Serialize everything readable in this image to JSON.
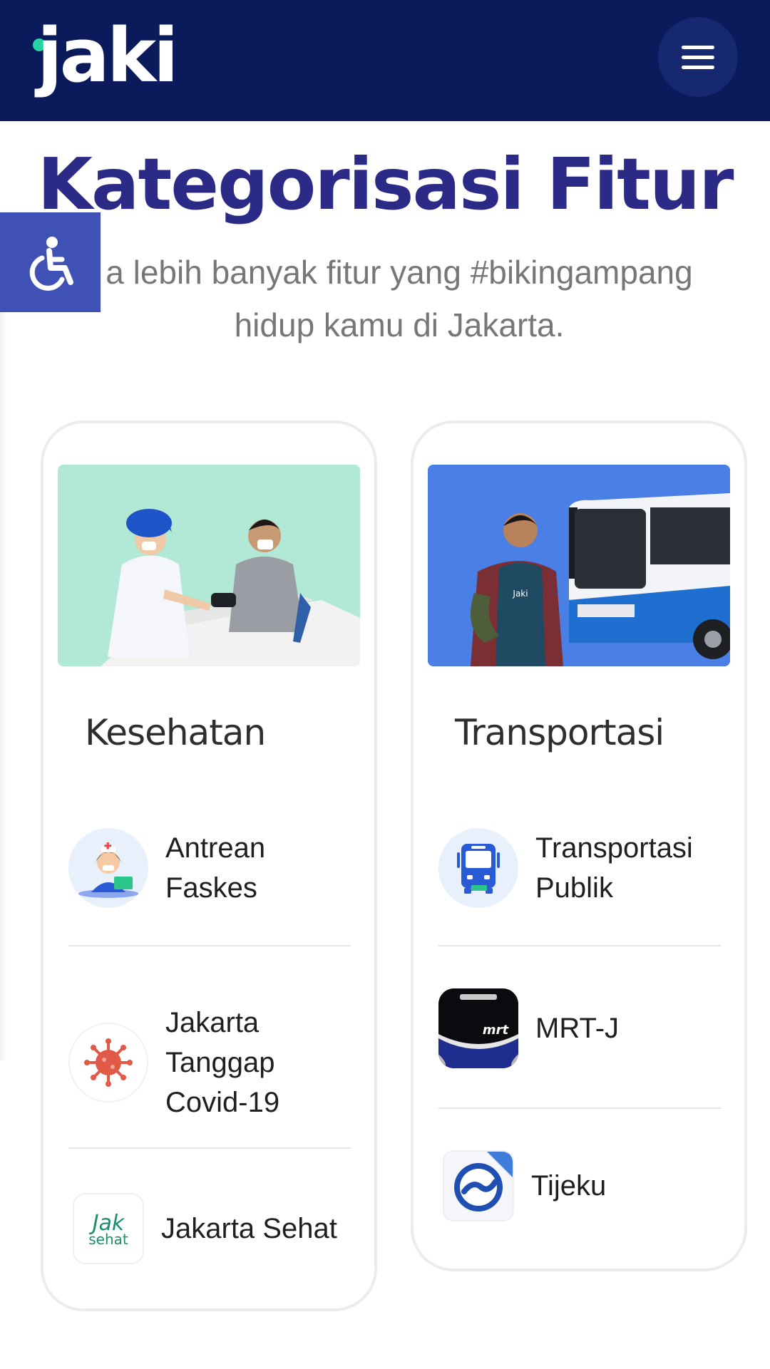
{
  "header": {
    "logo_text": "jaki",
    "logo_dot_color": "#27d3a2",
    "background_color": "#0b1a5a",
    "menu_icon": "hamburger-menu-icon"
  },
  "accessibility": {
    "icon": "wheelchair-icon",
    "color": "#3f51b5"
  },
  "main": {
    "title": "Kategorisasi Fitur",
    "subtitle": "a lebih banyak fitur yang #bikingampang hidup kamu di Jakarta.",
    "title_color": "#2b2a86"
  },
  "categories": [
    {
      "title": "Kesehatan",
      "image": "health-worker-checking-patient-illustration",
      "image_bg": "#b1e8d6",
      "features": [
        {
          "label": "Antrean Faskes",
          "icon": "nurse-icon"
        },
        {
          "label": "Jakarta Tanggap Covid-19",
          "icon": "virus-icon"
        },
        {
          "label": "Jakarta Sehat",
          "icon": "jak-sehat-logo-icon"
        }
      ]
    },
    {
      "title": "Transportasi",
      "image": "man-with-bus-illustration",
      "image_bg": "#4a7fe6",
      "features": [
        {
          "label": "Transportasi Publik",
          "icon": "bus-icon"
        },
        {
          "label": "MRT-J",
          "icon": "mrt-train-icon"
        },
        {
          "label": "Tijeku",
          "icon": "tijeku-logo-icon"
        }
      ]
    }
  ]
}
